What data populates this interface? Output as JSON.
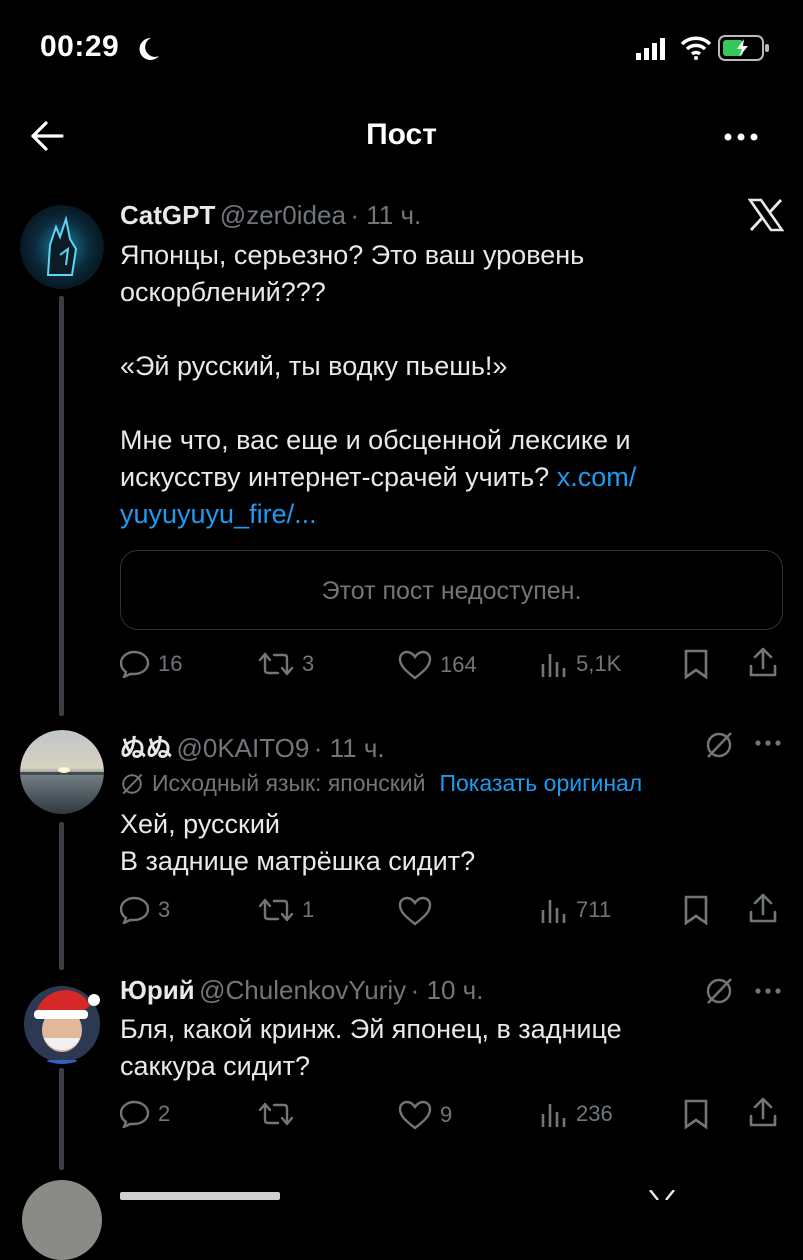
{
  "status": {
    "time": "00:29"
  },
  "header": {
    "title": "Пост"
  },
  "main_post": {
    "author_name": "CatGPT",
    "handle": "@zer0idea",
    "time": "· 11 ч.",
    "text_line1": "Японцы, серьезно? Это ваш уровень",
    "text_line2": "оскорблений???",
    "text_line3": "«Эй русский, ты водку пьешь!»",
    "text_line4": "Мне что, вас еще и обсценной лексике и",
    "text_line5": "искусству интернет-срачей учить?",
    "link_part1": "x.com/",
    "link_part2": "yuyuyuyu_fire/...",
    "quote_unavailable": "Этот пост недоступен.",
    "replies": "16",
    "reposts": "3",
    "likes": "164",
    "views": "5,1K"
  },
  "reply1": {
    "author_name": "ぬぬ",
    "handle": "@0KAITO9",
    "time": "· 11 ч.",
    "translate_label": "Исходный язык: японский",
    "show_original": "Показать оригинал",
    "text_line1": "Хей, русский",
    "text_line2": "В заднице матрёшка сидит?",
    "replies": "3",
    "reposts": "1",
    "likes": "",
    "views": "711"
  },
  "reply2": {
    "author_name": "Юрий",
    "handle": "@ChulenkovYuriy",
    "time": "· 10 ч.",
    "text_line1": "Бля, какой кринж. Эй японец, в заднице",
    "text_line2": "саккура сидит?",
    "replies": "2",
    "reposts": "",
    "likes": "9",
    "views": "236"
  },
  "colors": {
    "accent": "#1d9bf0",
    "muted": "#71767b",
    "background": "#000000"
  },
  "icons": [
    "back-arrow-icon",
    "more-icon",
    "x-logo-icon",
    "reply-icon",
    "repost-icon",
    "like-icon",
    "views-icon",
    "bookmark-icon",
    "share-icon",
    "translate-icon",
    "moon-icon",
    "signal-icon",
    "wifi-icon",
    "battery-icon"
  ]
}
